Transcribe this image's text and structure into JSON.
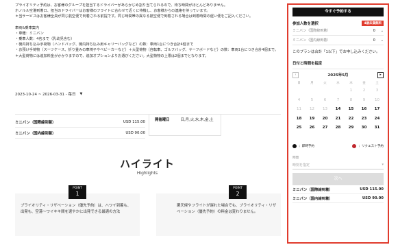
{
  "notes": [
    "プライオリティ予約は、お客様のグループを担当するドライバーがあらかじめ割り当てられるので、待ち時間がほとんどありません。",
    "ホノルル空港到着口、担当のドライバーはお客様のフライトに合わせて近くに待機し、お客様からの連絡を待っています。",
    "＊当サービスはお客様全員が同じ航空便で到着される前提です。同じ時間帯の異なる航空便で到着される場合は到着時間の遅い便をご記入ください。",
    "",
    "車両&乗車案内",
    "・車種：ミニバン",
    "・乗車人数：4名まで（乳幼児含む）",
    "・機内持ち込み手荷物（ハンドバッグ、機内持ち込み用キャリーバッグなど）の数：車両1台につき合計4個まで",
    "・お預け手荷物（スーツケース、折り畳みの車椅子やベビーカーなど）＋大型荷物（自転車、ゴルフバッグ、サーフボードなど）の数：車両1台につき合計4個まで。",
    "＊大型荷物には追加料金がかかりますので、追加オプションよりお選びください。大型荷物の上限は2個までとなります。"
  ],
  "date_range": "2023-10-24 ~ 2026-03-31 - 毎日",
  "prices": [
    {
      "name": "ミニバン（国際線到着）",
      "price": "USD 115.00"
    },
    {
      "name": "ミニバン（国内線到着）",
      "price": "USD 90.00"
    }
  ],
  "days": {
    "label": "開催曜日",
    "value": "日,月,火,水,木,金,土"
  },
  "highlights": {
    "title": "ハイライト",
    "subtitle": "Highlights"
  },
  "points": [
    {
      "label": "POINT",
      "num": "1",
      "text": "プライオリティ・リザベーション（優先予約）は、ハワイ到着も、出発も、空港〜ワイキキ間を速やかに出発できる最適の方法"
    },
    {
      "label": "POINT",
      "num": "2",
      "text": "悪天候やフライトが遅れた場合でも、プライオリティ・リザベーション（優先予約）の料金は変わりません。"
    }
  ],
  "booking": {
    "book_now": "今すぐ予約する",
    "pax_title": "参加人数を選択",
    "age_badge": "4歳未満無料",
    "pax": [
      {
        "label": "ミニバン（国際線到着）",
        "qty": "0"
      },
      {
        "label": "ミニバン（国内線到着）",
        "qty": "0"
      }
    ],
    "plan_note": "このプランは合計「1以下」でお申し込みください。",
    "date_title": "日付と時間を指定",
    "month": "2025年5月",
    "prev_icon": "‹",
    "next_icon": "▸",
    "weekdays": [
      "日",
      "月",
      "火",
      "水",
      "木",
      "金",
      "土"
    ],
    "first_weekday": 4,
    "days_in_month": 31,
    "first_available": 14,
    "legend_instant": "：即時予約",
    "legend_request": "：リクエスト予約",
    "instant_color": "#111111",
    "request_color": "#c0282d",
    "time_label": "時間",
    "time_placeholder": "時刻を指定",
    "next_btn": "次へ",
    "summary": [
      {
        "name": "ミニバン（国際線到着）",
        "price": "USD 115.00"
      },
      {
        "name": "ミニバン（国内線到着）",
        "price": "USD 90.00"
      }
    ]
  },
  "colors": {
    "accent": "#e03a2c"
  }
}
